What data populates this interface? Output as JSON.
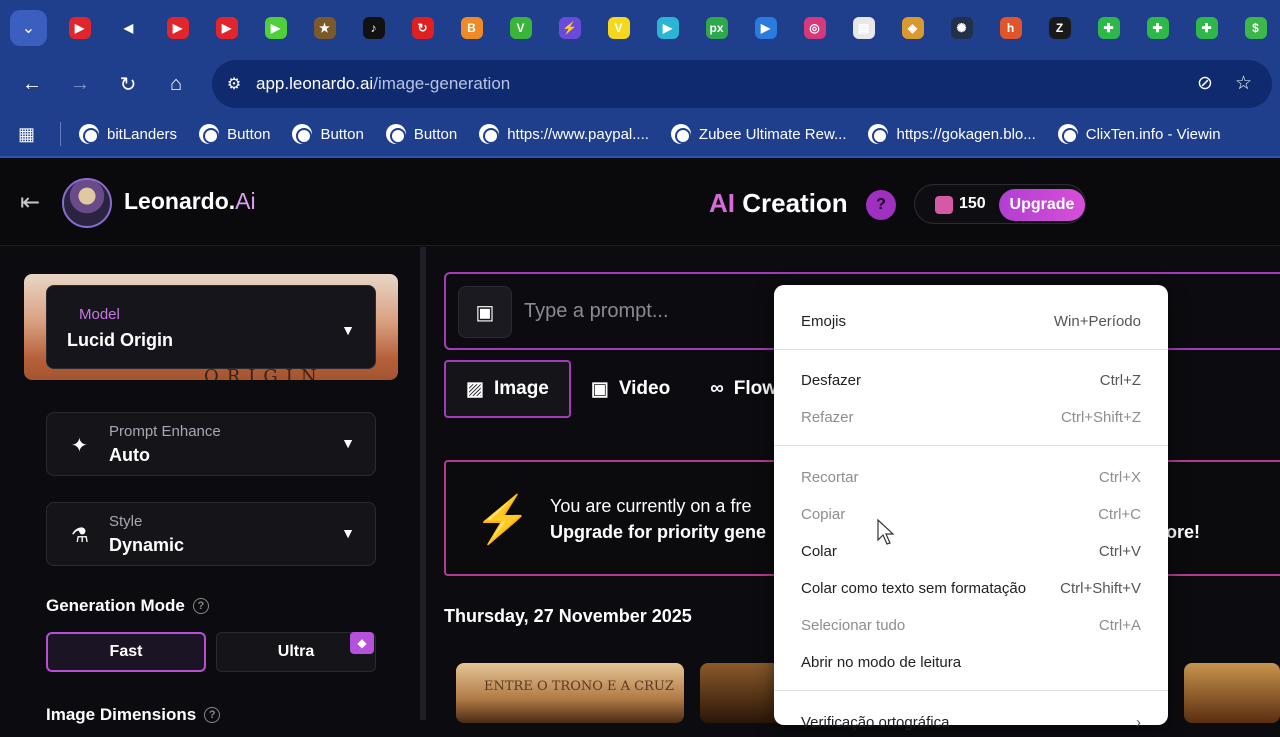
{
  "browser": {
    "url_host": "app.leonardo.ai",
    "url_path": "/image-generation",
    "favicons": [
      {
        "icon": "youtube-icon",
        "color": "#e0262c"
      },
      {
        "icon": "speaker-icon",
        "color": "#1f3e8c"
      },
      {
        "icon": "youtube-icon",
        "color": "#e0262c"
      },
      {
        "icon": "youtube-icon",
        "color": "#e0262c"
      },
      {
        "icon": "play-icon",
        "color": "#4fcf3a"
      },
      {
        "icon": "star-icon",
        "color": "#7a5a2a"
      },
      {
        "icon": "tiktok-icon",
        "color": "#111111"
      },
      {
        "icon": "refresh-icon",
        "color": "#e02020"
      },
      {
        "icon": "blogger-icon",
        "color": "#f08a24"
      },
      {
        "icon": "v-icon",
        "color": "#3ab53a"
      },
      {
        "icon": "bolt-icon",
        "color": "#6a4ad8"
      },
      {
        "icon": "v-icon",
        "color": "#f5d81e"
      },
      {
        "icon": "play-icon",
        "color": "#2bb4d4"
      },
      {
        "icon": "px-icon",
        "color": "#2ea84a"
      },
      {
        "icon": "play-icon",
        "color": "#2a7ae0"
      },
      {
        "icon": "instagram-icon",
        "color": "#d6387c"
      },
      {
        "icon": "doc-icon",
        "color": "#e8e8e8"
      },
      {
        "icon": "shield-icon",
        "color": "#d89a2e"
      },
      {
        "icon": "gear-icon",
        "color": "#22304a"
      },
      {
        "icon": "hub-icon",
        "color": "#e0562a"
      },
      {
        "icon": "z-icon",
        "color": "#1a1a1a"
      },
      {
        "icon": "puzzle-icon",
        "color": "#2fb84a"
      },
      {
        "icon": "puzzle-icon",
        "color": "#2fb84a"
      },
      {
        "icon": "puzzle-icon",
        "color": "#2fb84a"
      },
      {
        "icon": "dollar-icon",
        "color": "#3cb84a"
      }
    ],
    "bookmarks": [
      "bitLanders",
      "Button",
      "Button",
      "Button",
      "https://www.paypal....",
      "Zubee Ultimate Rew...",
      "https://gokagen.blo...",
      "ClixTen.info - Viewin"
    ]
  },
  "header": {
    "brand_name": "Leonardo.",
    "brand_suffix": "Ai",
    "title_ai": "AI",
    "title_rest": " Creation",
    "help_symbol": "?",
    "credits": "150",
    "upgrade_label": "Upgrade"
  },
  "sidebar": {
    "model_card_bg_text": "ORIGIN",
    "model_label": "Model",
    "model_value": "Lucid Origin",
    "prompt_enhance_label": "Prompt Enhance",
    "prompt_enhance_value": "Auto",
    "style_label": "Style",
    "style_value": "Dynamic",
    "generation_mode_title": "Generation Mode",
    "mode_fast": "Fast",
    "mode_ultra": "Ultra",
    "image_dimensions_title": "Image Dimensions"
  },
  "main": {
    "prompt_placeholder": "Type a prompt...",
    "tabs": [
      {
        "label": "Image",
        "icon": "image-icon"
      },
      {
        "label": "Video",
        "icon": "video-icon"
      },
      {
        "label": "Flow",
        "icon": "infinity-icon"
      }
    ],
    "banner_line1": "You are currently on a fre",
    "banner_line2": "Upgrade for priority gene",
    "banner_tail": "ore!",
    "date": "Thursday, 27 November 2025",
    "thumb1_text": "ENTRE O TRONO E A CRUZ"
  },
  "context_menu": {
    "items": [
      {
        "label": "Emojis",
        "shortcut": "Win+Período",
        "disabled": false
      },
      {
        "label": "Desfazer",
        "shortcut": "Ctrl+Z",
        "disabled": false
      },
      {
        "label": "Refazer",
        "shortcut": "Ctrl+Shift+Z",
        "disabled": true
      },
      {
        "label": "Recortar",
        "shortcut": "Ctrl+X",
        "disabled": true
      },
      {
        "label": "Copiar",
        "shortcut": "Ctrl+C",
        "disabled": true
      },
      {
        "label": "Colar",
        "shortcut": "Ctrl+V",
        "disabled": false
      },
      {
        "label": "Colar como texto sem formatação",
        "shortcut": "Ctrl+Shift+V",
        "disabled": false
      },
      {
        "label": "Selecionar tudo",
        "shortcut": "Ctrl+A",
        "disabled": true
      },
      {
        "label": "Abrir no modo de leitura",
        "shortcut": "",
        "disabled": false
      },
      {
        "label": "Verificação ortográfica",
        "shortcut": "",
        "disabled": false
      }
    ]
  }
}
